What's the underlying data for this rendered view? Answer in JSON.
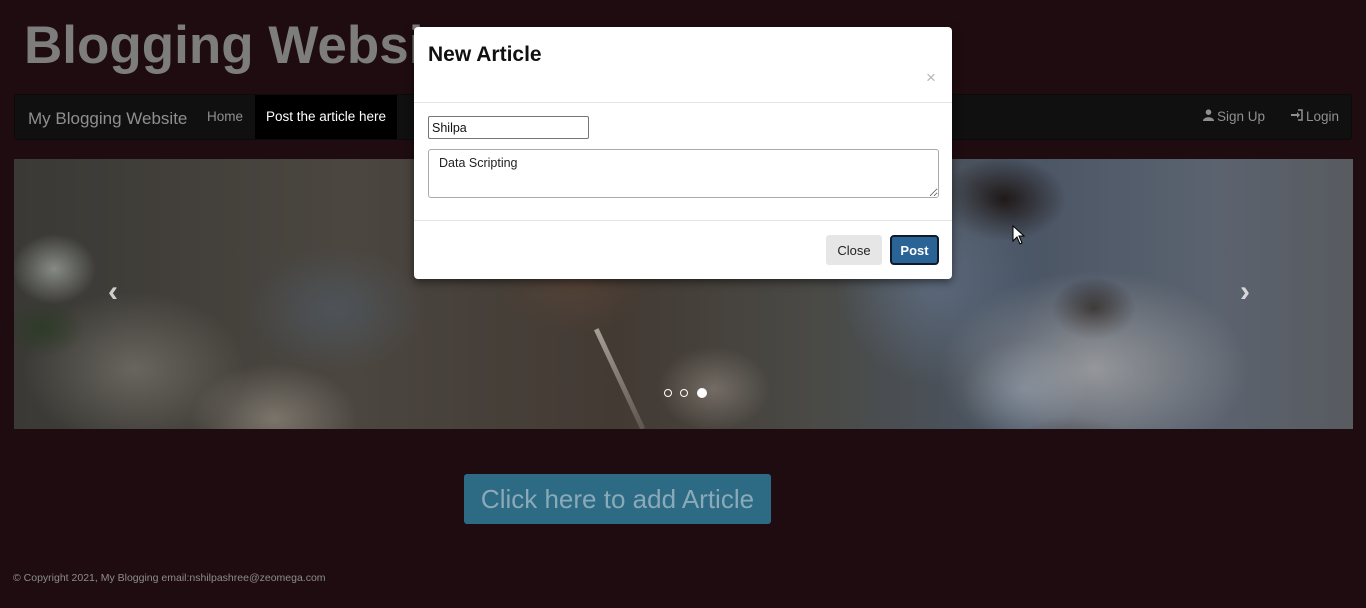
{
  "site": {
    "title": "Blogging Website"
  },
  "navbar": {
    "brand": "My Blogging Website",
    "items": [
      {
        "label": "Home"
      },
      {
        "label": "Post the article here",
        "active": true
      }
    ],
    "right_items": [
      {
        "label": "Sign Up",
        "icon": "user-icon"
      },
      {
        "label": "Login",
        "icon": "login-icon"
      }
    ]
  },
  "carousel": {
    "prev_glyph": "‹",
    "next_glyph": "›",
    "slide_count": 3,
    "active_index": 2
  },
  "main": {
    "add_article_label": "Click here to add Article"
  },
  "footer": {
    "text": "© Copyright 2021, My Blogging email:nshilpashree@zeomega.com"
  },
  "modal": {
    "title": "New Article",
    "close_glyph": "×",
    "name_value": "Shilpa",
    "article_value": "Data Scripting",
    "close_label": "Close",
    "post_label": "Post"
  },
  "colors": {
    "page_background": "#1f0c10",
    "primary_button": "#2a6496",
    "add_article_button": "#2d6a84"
  }
}
